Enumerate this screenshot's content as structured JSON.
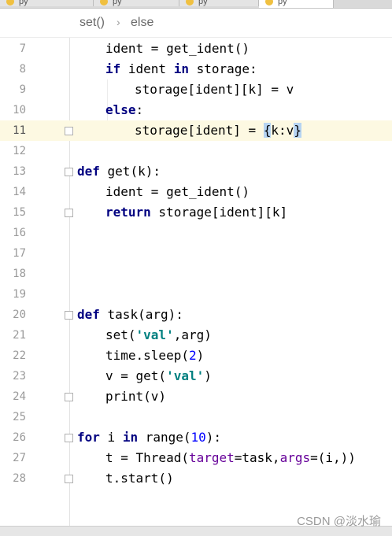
{
  "tabs": [
    {
      "label": "py"
    },
    {
      "label": "py"
    },
    {
      "label": "py"
    },
    {
      "label": "py"
    }
  ],
  "breadcrumb": {
    "items": [
      "set()",
      "else"
    ]
  },
  "editor": {
    "current_line": 11,
    "lines": [
      {
        "num": "7"
      },
      {
        "num": "8"
      },
      {
        "num": "9"
      },
      {
        "num": "10"
      },
      {
        "num": "11"
      },
      {
        "num": "12"
      },
      {
        "num": "13"
      },
      {
        "num": "14"
      },
      {
        "num": "15"
      },
      {
        "num": "16"
      },
      {
        "num": "17"
      },
      {
        "num": "18"
      },
      {
        "num": "19"
      },
      {
        "num": "20"
      },
      {
        "num": "21"
      },
      {
        "num": "22"
      },
      {
        "num": "23"
      },
      {
        "num": "24"
      },
      {
        "num": "25"
      },
      {
        "num": "26"
      },
      {
        "num": "27"
      },
      {
        "num": "28"
      }
    ],
    "code": {
      "l7": {
        "a": "ident = get_ident()"
      },
      "l8": {
        "kw1": "if",
        "a": " ident ",
        "kw2": "in",
        "b": " storage:"
      },
      "l9": {
        "a": "storage[ident][k] = v"
      },
      "l10": {
        "kw": "else",
        "a": ":"
      },
      "l11": {
        "a": "storage[ident] = ",
        "b1": "{",
        "b": "k:v",
        "b2": "}"
      },
      "l13": {
        "kw": "def",
        "a": " get(k):"
      },
      "l14": {
        "a": "ident = get_ident()"
      },
      "l15": {
        "kw": "return",
        "a": " storage[ident][k]"
      },
      "l20": {
        "kw": "def",
        "a": " task(arg):"
      },
      "l21": {
        "a": "set(",
        "s": "'val'",
        "b": ",arg)"
      },
      "l22": {
        "a": "time.sleep(",
        "n": "2",
        "b": ")"
      },
      "l23": {
        "a": "v = get(",
        "s": "'val'",
        "b": ")"
      },
      "l24": {
        "a": "print(v)"
      },
      "l26": {
        "kw1": "for",
        "a": " i ",
        "kw2": "in",
        "b": " range(",
        "n": "10",
        "c": "):"
      },
      "l27": {
        "a": "t = Thread(",
        "p1": "target",
        "b": "=task,",
        "p2": "args",
        "c": "=(i,))"
      },
      "l28": {
        "a": "t.start()"
      }
    }
  },
  "watermark": "CSDN @淡水瑜",
  "colors": {
    "keyword": "#000080",
    "string": "#008080",
    "number": "#0000ff",
    "param": "#660099",
    "current_line": "#fdf9e2",
    "brace_highlight": "#b6d4f2"
  }
}
